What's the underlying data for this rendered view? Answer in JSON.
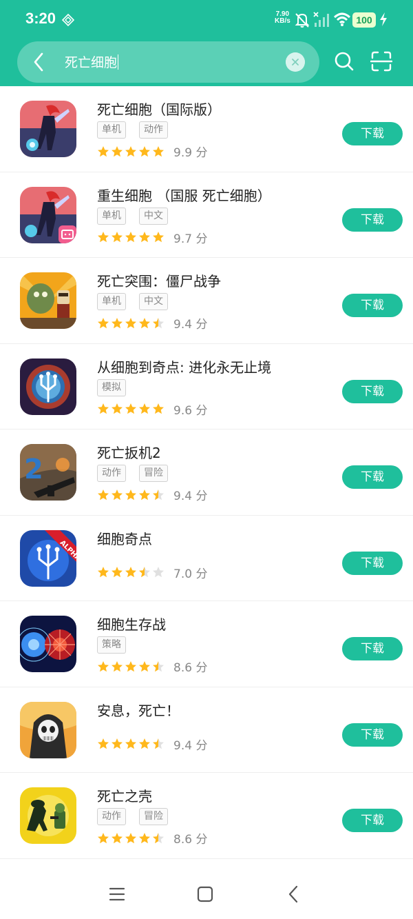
{
  "status_bar": {
    "time": "3:20",
    "net_speed_value": "7.90",
    "net_speed_unit": "KB/s",
    "battery": "100"
  },
  "search": {
    "query": "死亡细胞"
  },
  "apps": [
    {
      "name": "死亡细胞（国际版）",
      "tags": [
        "单机",
        "动作"
      ],
      "stars": 5,
      "score": "9.9 分"
    },
    {
      "name": "重生细胞 （国服 死亡细胞）",
      "tags": [
        "单机",
        "中文"
      ],
      "stars": 5,
      "score": "9.7 分"
    },
    {
      "name": "死亡突围：僵尸战争",
      "tags": [
        "单机",
        "中文"
      ],
      "stars": 4.5,
      "score": "9.4 分"
    },
    {
      "name": "从细胞到奇点: 进化永无止境",
      "tags": [
        "模拟"
      ],
      "stars": 5,
      "score": "9.6 分"
    },
    {
      "name": "死亡扳机2",
      "tags": [
        "动作",
        "冒险"
      ],
      "stars": 4.5,
      "score": "9.4 分"
    },
    {
      "name": "细胞奇点",
      "tags": [],
      "stars": 3.5,
      "score": "7.0 分",
      "badge": "ALPHA"
    },
    {
      "name": "细胞生存战",
      "tags": [
        "策略"
      ],
      "stars": 4.5,
      "score": "8.6 分"
    },
    {
      "name": "安息，死亡！",
      "tags": [],
      "stars": 4.5,
      "score": "9.4 分"
    },
    {
      "name": "死亡之壳",
      "tags": [
        "动作",
        "冒险"
      ],
      "stars": 4.5,
      "score": "8.6 分"
    }
  ],
  "download_label": "下载",
  "colors": {
    "accent": "#1fbf9c",
    "star": "#ffb81c",
    "star_empty": "#e0e0e0"
  }
}
